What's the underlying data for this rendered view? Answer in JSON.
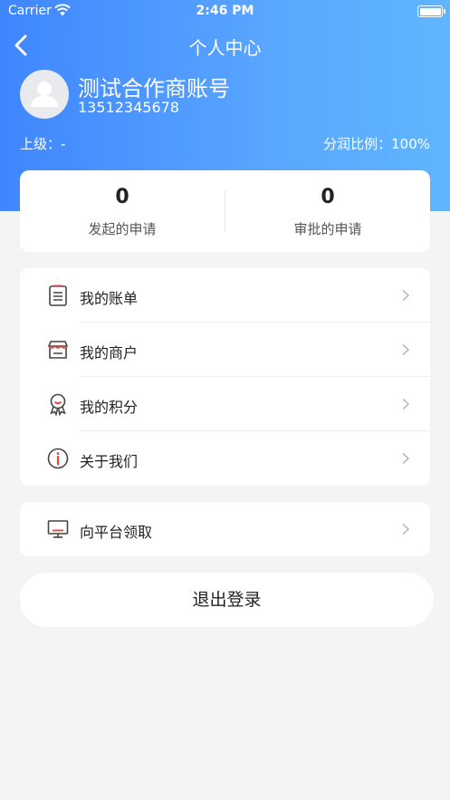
{
  "status_bar": {
    "carrier": "Carrier",
    "time": "2:46 PM"
  },
  "nav": {
    "title": "个人中心"
  },
  "profile": {
    "name": "测试合作商账号",
    "phone": "13512345678"
  },
  "meta": {
    "superior": "上级：-",
    "profit_ratio": "分润比例：100%"
  },
  "stats": [
    {
      "value": "0",
      "label": "发起的申请"
    },
    {
      "value": "0",
      "label": "审批的申请"
    }
  ],
  "menu": [
    {
      "label": "我的账单",
      "icon": "bill-icon"
    },
    {
      "label": "我的商户",
      "icon": "store-icon"
    },
    {
      "label": "我的积分",
      "icon": "badge-icon"
    },
    {
      "label": "关于我们",
      "icon": "info-icon"
    }
  ],
  "menu2": [
    {
      "label": "向平台领取",
      "icon": "monitor-icon"
    }
  ],
  "logout_label": "退出登录",
  "colors": {
    "header_start": "#3f86ff",
    "header_end": "#5fb6ff",
    "accent_red": "#e8403a",
    "icon_gray": "#444444"
  }
}
